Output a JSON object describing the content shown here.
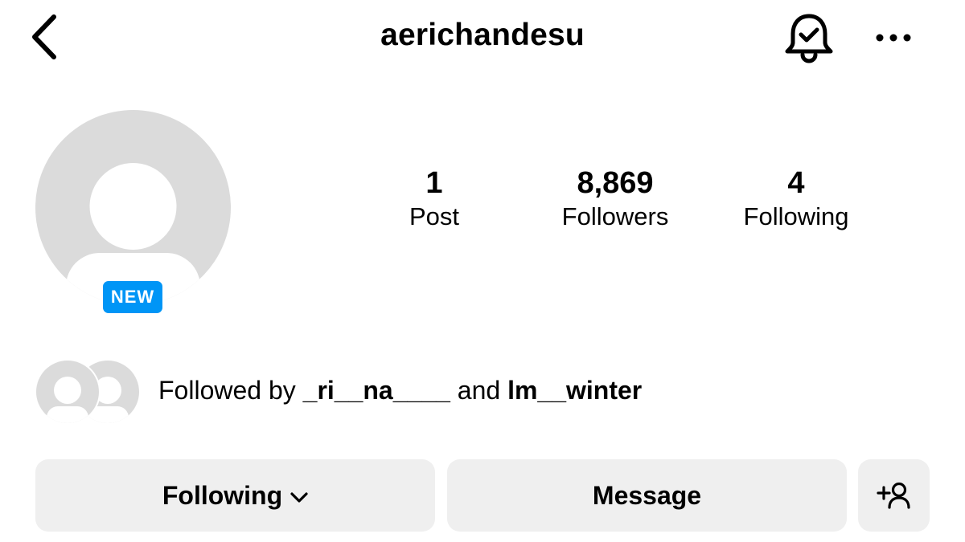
{
  "header": {
    "back_icon": "chevron-left-icon",
    "username": "aerichandesu",
    "notification_icon": "bell-check-icon",
    "more_icon": "more-horizontal-icon"
  },
  "avatar": {
    "icon": "default-avatar-icon",
    "badge": "NEW",
    "badge_color": "#0095f6"
  },
  "stats": {
    "posts": {
      "value": "1",
      "label": "Post"
    },
    "followers": {
      "value": "8,869",
      "label": "Followers"
    },
    "following": {
      "value": "4",
      "label": "Following"
    }
  },
  "followed_by": {
    "prefix": "Followed by ",
    "user1": "_ri__na____",
    "conjunction": " and ",
    "user2": "lm__winter"
  },
  "actions": {
    "following_label": "Following",
    "following_icon": "chevron-down-icon",
    "message_label": "Message",
    "add_user_icon": "add-user-icon"
  },
  "colors": {
    "button_bg": "#efefef",
    "avatar_gray": "#dbdbdb"
  }
}
